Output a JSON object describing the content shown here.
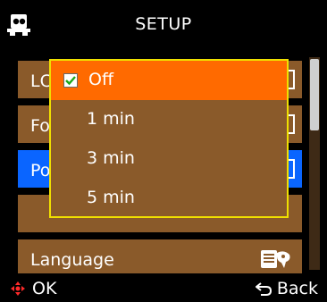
{
  "header": {
    "title": "SETUP",
    "icon": "video-camera-mode-icon"
  },
  "menu": {
    "rows": [
      {
        "label": "LC",
        "value_icon": "toggle-indicator"
      },
      {
        "label": "Fo",
        "value_icon": "toggle-indicator"
      },
      {
        "label": "Po",
        "value_icon": "toggle-indicator",
        "highlighted": true
      },
      {
        "label": ""
      },
      {
        "label": "Language",
        "icon": "language-icon"
      }
    ]
  },
  "popup": {
    "options": [
      {
        "label": "Off",
        "selected": true
      },
      {
        "label": "1 min"
      },
      {
        "label": "3 min"
      },
      {
        "label": "5 min"
      }
    ]
  },
  "footer": {
    "ok_label": "OK",
    "back_label": "Back"
  },
  "colors": {
    "row_bg": "#8a5a2a",
    "row_selected": "#0a65ff",
    "popup_border": "#f0e000",
    "option_selected": "#ff6a00"
  }
}
